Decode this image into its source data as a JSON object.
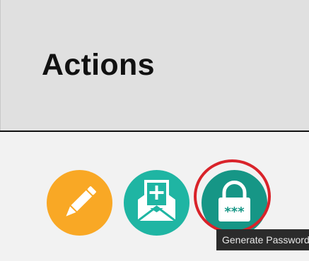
{
  "header": {
    "title": "Actions"
  },
  "actions": [
    {
      "name": "edit",
      "icon": "pencil-icon",
      "color": "#f9a825"
    },
    {
      "name": "new-message",
      "icon": "envelope-plus-icon",
      "color": "#1fb5a3"
    },
    {
      "name": "generate-password",
      "icon": "lock-password-icon",
      "color": "#169686"
    }
  ],
  "tooltip": {
    "text": "Generate Password"
  },
  "highlight": {
    "color": "#d9232a"
  }
}
